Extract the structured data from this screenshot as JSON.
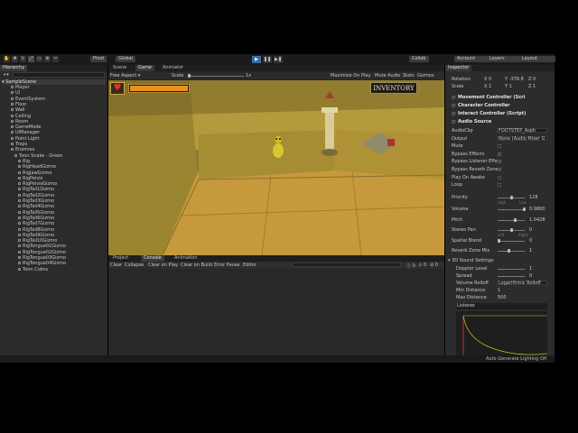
{
  "toolbar": {
    "pivot": "Pivot",
    "global": "Global",
    "collab": "Collab",
    "account": "Account",
    "layers": "Layers",
    "layout": "Layout"
  },
  "hierarchy": {
    "title": "Hierarchy",
    "search_placeholder": "",
    "scene": "SampleScene",
    "items": [
      {
        "label": "Player",
        "depth": 2
      },
      {
        "label": "UI",
        "depth": 2
      },
      {
        "label": "EventSystem",
        "depth": 2
      },
      {
        "label": "Floor",
        "depth": 2
      },
      {
        "label": "Wall",
        "depth": 2
      },
      {
        "label": "Ceiling",
        "depth": 2
      },
      {
        "label": "Room",
        "depth": 2
      },
      {
        "label": "GameMode",
        "depth": 2
      },
      {
        "label": "UIManager",
        "depth": 2
      },
      {
        "label": "Point Light",
        "depth": 2
      },
      {
        "label": "Traps",
        "depth": 2
      },
      {
        "label": "Enemies",
        "depth": 2
      },
      {
        "label": "Toon Snake - Green",
        "depth": 3
      },
      {
        "label": "Rig",
        "depth": 4
      },
      {
        "label": "RigHeadGizmo",
        "depth": 4
      },
      {
        "label": "RigJawGizmo",
        "depth": 4
      },
      {
        "label": "RigPelvis",
        "depth": 4
      },
      {
        "label": "RigPelvisGizmo",
        "depth": 4
      },
      {
        "label": "RigTail1Gizmo",
        "depth": 4
      },
      {
        "label": "RigTail2Gizmo",
        "depth": 4
      },
      {
        "label": "RigTail3Gizmo",
        "depth": 4
      },
      {
        "label": "RigTail4Gizmo",
        "depth": 4
      },
      {
        "label": "RigTail5Gizmo",
        "depth": 4
      },
      {
        "label": "RigTail6Gizmo",
        "depth": 4
      },
      {
        "label": "RigTail7Gizmo",
        "depth": 4
      },
      {
        "label": "RigTail8Gizmo",
        "depth": 4
      },
      {
        "label": "RigTail9Gizmo",
        "depth": 4
      },
      {
        "label": "RigTail10Gizmo",
        "depth": 4
      },
      {
        "label": "RigTongue01Gizmo",
        "depth": 4
      },
      {
        "label": "RigTongue02Gizmo",
        "depth": 4
      },
      {
        "label": "RigTongue03Gizmo",
        "depth": 4
      },
      {
        "label": "RigTongue04Gizmo",
        "depth": 4
      },
      {
        "label": "Toon Cobra",
        "depth": 4
      }
    ]
  },
  "game_view": {
    "tabs": [
      "Scene",
      "Game",
      "Animator"
    ],
    "aspect": "Free Aspect",
    "scale_label": "Scale",
    "scale_value": "1x",
    "maximize": "Maximize On Play",
    "mute": "Mute Audio",
    "stats": "Stats",
    "gizmos": "Gizmos",
    "inventory": "INVENTORY"
  },
  "console": {
    "tabs": [
      "Project",
      "Console",
      "Animation"
    ],
    "buttons": [
      "Clear",
      "Collapse",
      "Clear on Play",
      "Clear on Build",
      "Error Pause",
      "Editor"
    ],
    "counts": [
      "0",
      "0",
      "0"
    ]
  },
  "inspector": {
    "title": "Inspector",
    "transform": {
      "rotation_label": "Rotation",
      "rotation": [
        "X 0",
        "Y -378.8",
        "Z 0"
      ],
      "scale_label": "Scale",
      "scale": [
        "X 1",
        "Y 1",
        "Z 1"
      ]
    },
    "components": [
      "Movement Controller (Scri",
      "Character Controller",
      "Interact Controller (Script)",
      "Audio Source"
    ],
    "audio": [
      {
        "label": "AudioClip",
        "value": "FOOTSTEP_Asph"
      },
      {
        "label": "Output",
        "value": "None (Audio Mixer G"
      },
      {
        "label": "Mute",
        "value": ""
      },
      {
        "label": "Bypass Effects",
        "value": ""
      },
      {
        "label": "Bypass Listener Effe",
        "value": ""
      },
      {
        "label": "Bypass Reverb Zone",
        "value": ""
      },
      {
        "label": "Play On Awake",
        "value": ""
      },
      {
        "label": "Loop",
        "value": ""
      }
    ],
    "priority_label": "Priority",
    "priority": "128",
    "priority_high": "High",
    "priority_low": "Low",
    "volume_label": "Volume",
    "volume": "0.9800",
    "pitch_label": "Pitch",
    "pitch": "1.0428",
    "stereo_label": "Stereo Pan",
    "stereo": "0",
    "stereo_left": "Left",
    "stereo_right": "Right",
    "spatial_label": "Spatial Blend",
    "spatial": "0",
    "reverb_label": "Reverb Zone Mix",
    "reverb": "1",
    "sound3d": "3D Sound Settings",
    "doppler_label": "Doppler Level",
    "doppler": "1",
    "spread_label": "Spread",
    "spread": "0",
    "rolloff_label": "Volume Rolloff",
    "rolloff": "Logarithmic Rolloff",
    "min_label": "Min Distance",
    "min": "1",
    "max_label": "Max Distance",
    "max": "500",
    "listener": "Listener",
    "status": "Auto Generate Lighting Off"
  }
}
